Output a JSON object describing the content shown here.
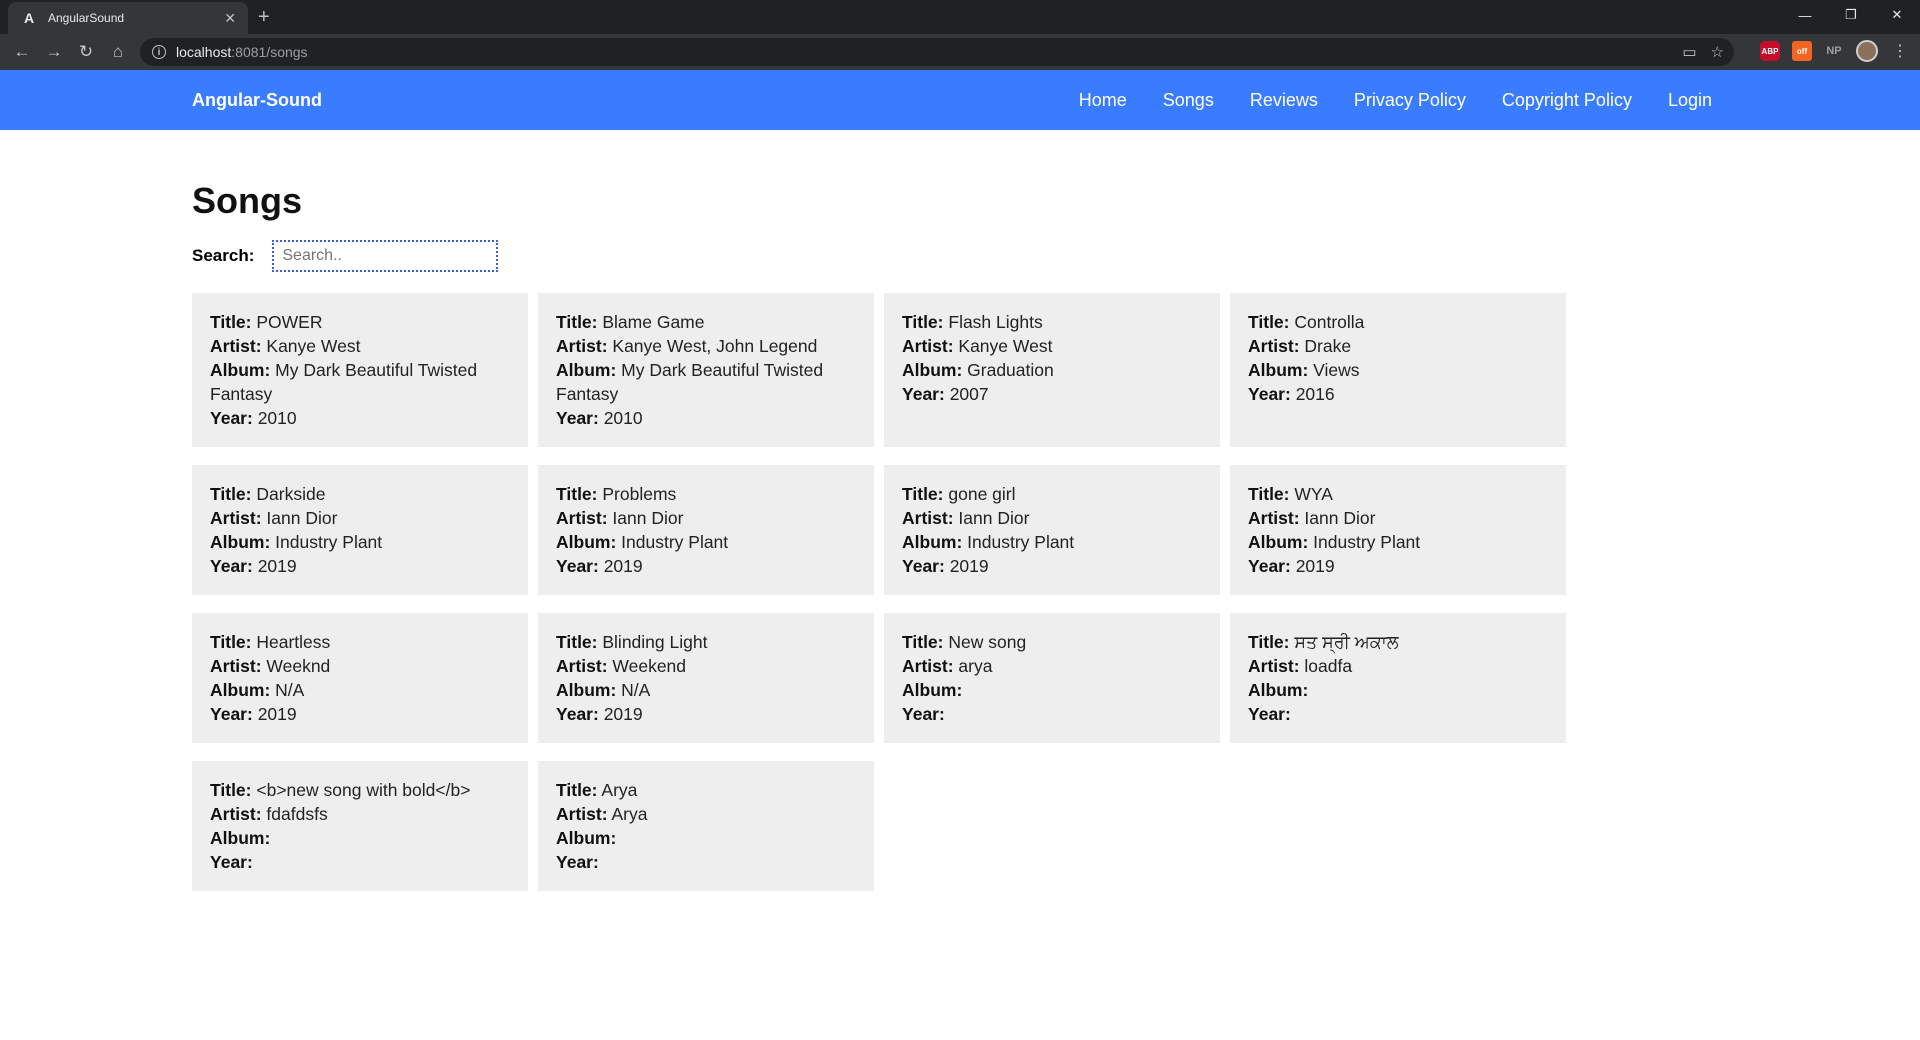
{
  "browser": {
    "tab_title": "AngularSound",
    "tab_favicon": "A",
    "new_tab": "+",
    "url_host": "localhost",
    "url_path": ":8081/songs",
    "extensions": {
      "abp": "ABP",
      "rss": "off",
      "np": "NP"
    }
  },
  "nav": {
    "brand": "Angular-Sound",
    "links": [
      "Home",
      "Songs",
      "Reviews",
      "Privacy Policy",
      "Copyright Policy",
      "Login"
    ]
  },
  "page": {
    "title": "Songs",
    "search_label": "Search:",
    "search_placeholder": "Search.."
  },
  "labels": {
    "title": "Title:",
    "artist": "Artist:",
    "album": "Album:",
    "year": "Year:"
  },
  "songs": [
    {
      "title": "POWER",
      "artist": "Kanye West",
      "album": "My Dark Beautiful Twisted Fantasy",
      "year": "2010"
    },
    {
      "title": "Blame Game",
      "artist": "Kanye West, John Legend",
      "album": "My Dark Beautiful Twisted Fantasy",
      "year": "2010"
    },
    {
      "title": "Flash Lights",
      "artist": "Kanye West",
      "album": "Graduation",
      "year": "2007"
    },
    {
      "title": "Controlla",
      "artist": "Drake",
      "album": "Views",
      "year": "2016"
    },
    {
      "title": "Darkside",
      "artist": "Iann Dior",
      "album": "Industry Plant",
      "year": "2019"
    },
    {
      "title": "Problems",
      "artist": "Iann Dior",
      "album": "Industry Plant",
      "year": "2019"
    },
    {
      "title": "gone girl",
      "artist": "Iann Dior",
      "album": "Industry Plant",
      "year": "2019"
    },
    {
      "title": "WYA",
      "artist": "Iann Dior",
      "album": "Industry Plant",
      "year": "2019"
    },
    {
      "title": "Heartless",
      "artist": "Weeknd",
      "album": "N/A",
      "year": "2019"
    },
    {
      "title": "Blinding Light",
      "artist": "Weekend",
      "album": "N/A",
      "year": "2019"
    },
    {
      "title": "New song",
      "artist": "arya",
      "album": "",
      "year": ""
    },
    {
      "title": "ਸਤ ਸ੍ਰੀ ਅਕਾਲ",
      "artist": "loadfa",
      "album": "",
      "year": ""
    },
    {
      "title": "<b>new song with bold</b>",
      "artist": "fdafdsfs",
      "album": "",
      "year": ""
    },
    {
      "title": "Arya",
      "artist": "Arya",
      "album": "",
      "year": ""
    }
  ]
}
